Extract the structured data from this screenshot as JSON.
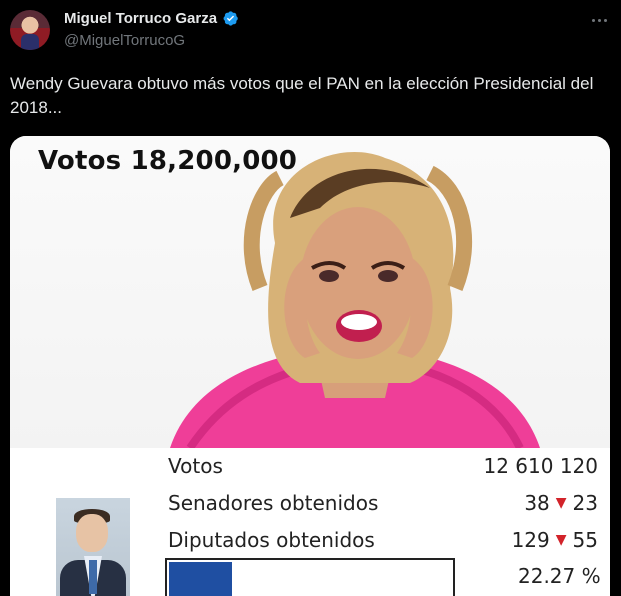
{
  "tweet": {
    "author_name": "Miguel Torruco Garza",
    "author_handle": "@MiguelTorrucoG",
    "text": "Wendy Guevara obtuvo más votos que el PAN en la elección Presidencial del 2018...",
    "colors": {
      "background": "#000000",
      "text": "#e7e9ea",
      "muted": "#71767b",
      "verified": "#1d9bf0"
    }
  },
  "media": {
    "headline": "Votos 18,200,000",
    "results": [
      {
        "label": "Votos",
        "value": "12 610 120"
      },
      {
        "label": "Senadores obtenidos",
        "value": "38",
        "change": "23"
      },
      {
        "label": "Diputados obtenidos",
        "value": "129",
        "change": "55"
      }
    ],
    "progress": {
      "percent_label": "22.27 %",
      "fraction": 0.2227,
      "color": "#1f4fa2"
    },
    "down_color": "#d2232a"
  }
}
